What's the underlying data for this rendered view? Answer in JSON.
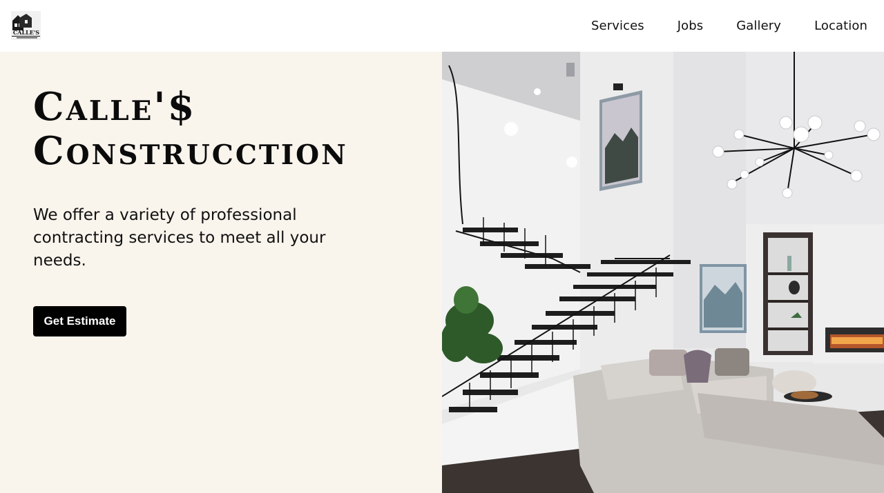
{
  "header": {
    "logo_alt": "CALLE'S CONSTRUCTION",
    "nav": [
      {
        "label": "Services"
      },
      {
        "label": "Jobs"
      },
      {
        "label": "Gallery"
      },
      {
        "label": "Location"
      }
    ]
  },
  "hero": {
    "title_line1": "Calle'$",
    "title_line2": "Construcction",
    "tagline": "We offer a variety of professional contracting services to meet all your needs.",
    "cta_label": "Get Estimate",
    "image_alt": "Modern living room interior with staircase and chandelier"
  },
  "colors": {
    "hero_bg": "#f9f4ec",
    "button_bg": "#000000",
    "text": "#111111"
  }
}
